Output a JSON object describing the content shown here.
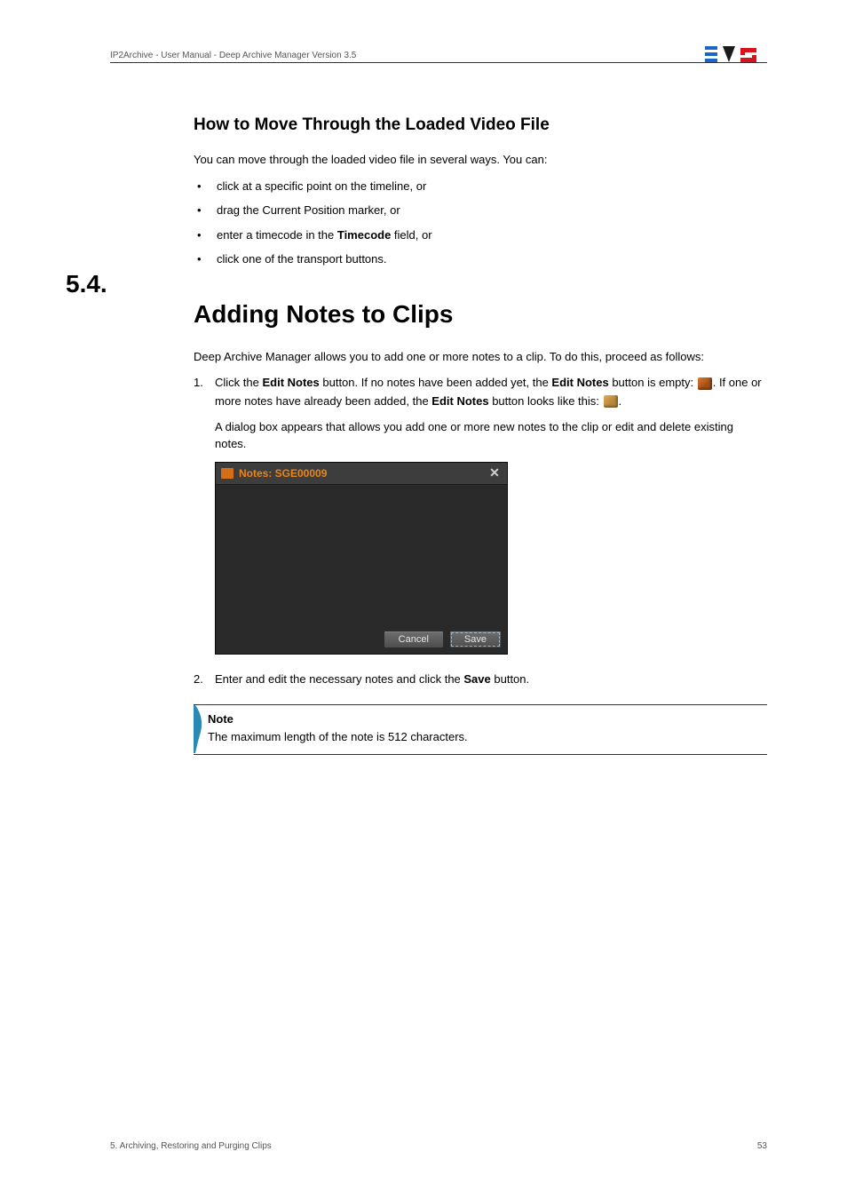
{
  "header": {
    "doc_title": "IP2Archive - User Manual - Deep Archive Manager Version 3.5"
  },
  "section1": {
    "heading": "How to Move Through the Loaded Video File",
    "intro": "You can move through the loaded video file in several ways. You can:",
    "bullets": [
      "click at a specific point on the timeline, or",
      "drag the Current Position marker, or",
      "",
      "click one of the transport buttons."
    ],
    "bullet3_pre": "enter a timecode in the ",
    "bullet3_bold": "Timecode",
    "bullet3_post": " field, or"
  },
  "section2": {
    "number": "5.4.",
    "title": "Adding Notes to Clips",
    "intro": "Deep Archive Manager allows you to add one or more notes to a clip. To do this, proceed as follows:",
    "step1_a": "Click the ",
    "step1_b": "Edit Notes",
    "step1_c": " button. If no notes have been added yet, the ",
    "step1_d": "Edit Notes",
    "step1_e": " button is empty: ",
    "step1_f": ". If one or more notes have already been added, the ",
    "step1_g": "Edit Notes",
    "step1_h": " button looks like this: ",
    "step1_i": ".",
    "step1_note": "A dialog box appears that allows you add one or more new notes to the clip or edit and delete existing notes.",
    "dialog": {
      "title": "Notes: SGE00009",
      "cancel": "Cancel",
      "save": "Save"
    },
    "step2_a": "Enter and edit the necessary notes and click the ",
    "step2_b": "Save",
    "step2_c": " button.",
    "note_label": "Note",
    "note_text": "The maximum length of the note is 512 characters."
  },
  "footer": {
    "left": "5. Archiving, Restoring and Purging Clips",
    "right": "53"
  }
}
